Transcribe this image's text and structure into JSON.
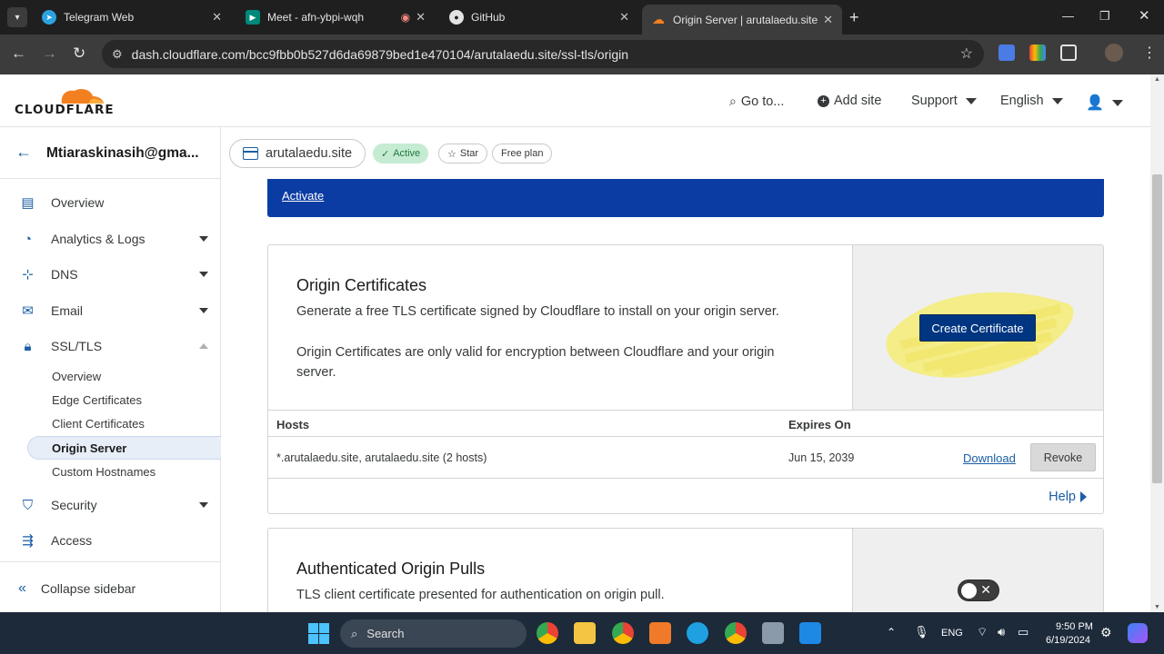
{
  "browser": {
    "tabs": [
      {
        "title": "Telegram Web",
        "icon": "telegram-icon",
        "color": "#2aa3e0"
      },
      {
        "title": "Meet - afn-ybpi-wqh",
        "icon": "meet-icon",
        "color": "#00897b"
      },
      {
        "title": "GitHub",
        "icon": "github-icon",
        "color": "#e3e3e3"
      },
      {
        "title": "Origin Server | arutalaedu.site | C",
        "icon": "cloudflare-icon",
        "color": "#f38020"
      }
    ],
    "url": "dash.cloudflare.com/bcc9fbb0b527d6da69879bed1e470104/arutalaedu.site/ssl-tls/origin"
  },
  "header": {
    "logo_text": "CLOUDFLARE",
    "goto": "Go to...",
    "add_site": "Add site",
    "support": "Support",
    "language": "English"
  },
  "account": {
    "name": "Mtiaraskinasih@gma..."
  },
  "zone": {
    "domain": "arutalaedu.site",
    "status": "Active",
    "star": "Star",
    "plan": "Free plan"
  },
  "sidebar": {
    "items": [
      {
        "label": "Overview",
        "icon": "document-icon"
      },
      {
        "label": "Analytics & Logs",
        "icon": "analytics-icon"
      },
      {
        "label": "DNS",
        "icon": "dns-icon"
      },
      {
        "label": "Email",
        "icon": "email-icon"
      },
      {
        "label": "SSL/TLS",
        "icon": "lock-icon"
      },
      {
        "label": "Security",
        "icon": "shield-icon"
      },
      {
        "label": "Access",
        "icon": "access-icon"
      }
    ],
    "ssl_sub": [
      "Overview",
      "Edge Certificates",
      "Client Certificates",
      "Origin Server",
      "Custom Hostnames"
    ],
    "collapse": "Collapse sidebar"
  },
  "banner": {
    "link": "Activate"
  },
  "origin": {
    "title": "Origin Certificates",
    "desc1": "Generate a free TLS certificate signed by Cloudflare to install on your origin server.",
    "desc2": "Origin Certificates are only valid for encryption between Cloudflare and your origin server.",
    "button": "Create Certificate",
    "col_hosts": "Hosts",
    "col_expires": "Expires On",
    "row_hosts": "*.arutalaedu.site, arutalaedu.site (2 hosts)",
    "row_expires": "Jun 15, 2039",
    "download": "Download",
    "revoke": "Revoke",
    "help": "Help"
  },
  "aop": {
    "title": "Authenticated Origin Pulls",
    "desc": "TLS client certificate presented for authentication on origin pull.",
    "toggle": "off"
  },
  "taskbar": {
    "search": "Search",
    "lang": "ENG",
    "time": "9:50 PM",
    "date": "6/19/2024"
  }
}
